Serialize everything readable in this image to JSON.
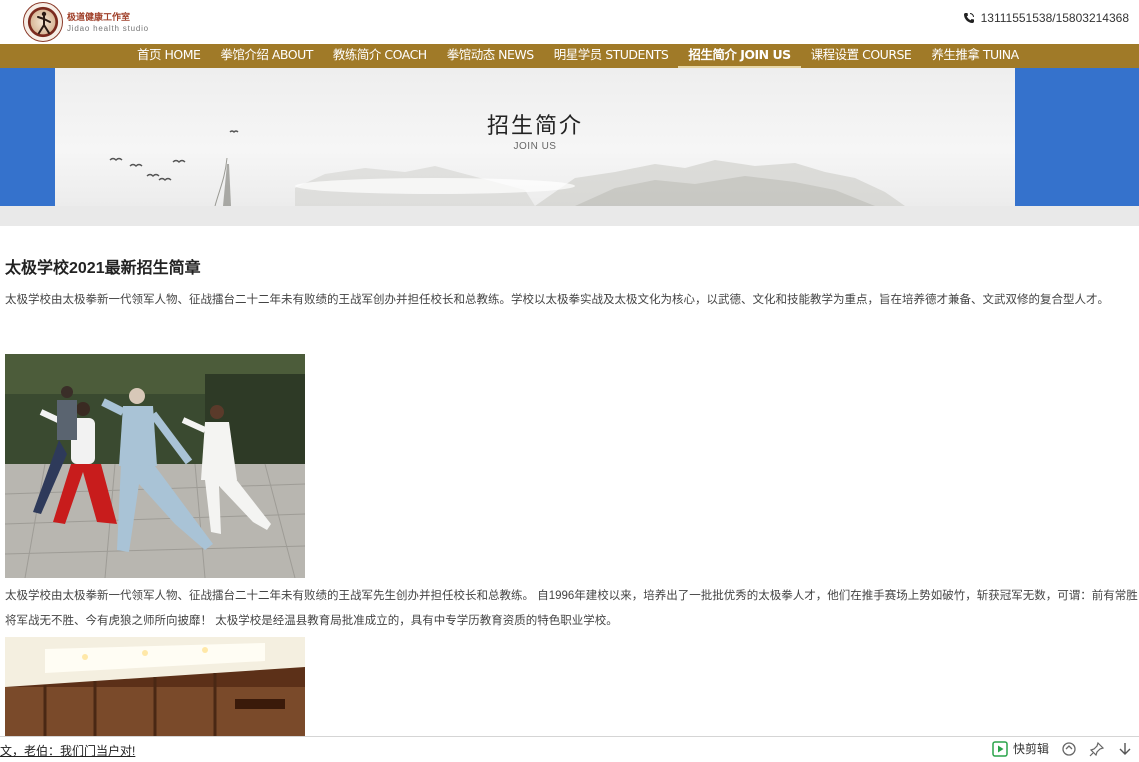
{
  "header": {
    "logo_cn": "极道健康工作室",
    "logo_en": "Jidao health studio",
    "phone": "13111551538/15803214368"
  },
  "nav": {
    "items": [
      {
        "label": "首页 HOME"
      },
      {
        "label": "拳馆介绍 ABOUT"
      },
      {
        "label": "教练简介 COACH"
      },
      {
        "label": "拳馆动态 NEWS"
      },
      {
        "label": "明星学员 STUDENTS"
      },
      {
        "label": "招生简介 JOIN US",
        "active": true
      },
      {
        "label": "课程设置 COURSE"
      },
      {
        "label": "养生推拿 TUINA"
      }
    ]
  },
  "banner": {
    "title": "招生简介",
    "subtitle": "JOIN US",
    "side_color": "#3572cc"
  },
  "article": {
    "title": "太极学校2021最新招生简章",
    "para1": "太极学校由太极拳新一代领军人物、征战擂台二十二年未有败绩的王战军创办并担任校长和总教练。学校以太极拳实战及太极文化为核心，以武德、文化和技能教学为重点，旨在培养德才兼备、文武双修的复合型人才。",
    "para2": "太极学校由太极拳新一代领军人物、征战擂台二十二年未有败绩的王战军先生创办并担任校长和总教练。 自1996年建校以来，培养出了一批批优秀的太极拳人才，他们在推手赛场上势如破竹，斩获冠军无数，可谓：前有常胜将军战无不胜、今有虎狼之师所向披靡！ 太极学校是经温县教育局批准成立的，具有中专学历教育资质的特色职业学校。"
  },
  "statusbar": {
    "text": "文，老伯：我们门当户对!",
    "clip_label": "快剪辑"
  },
  "colors": {
    "nav_bg": "#a07a28",
    "accent_blue": "#3572cc"
  }
}
